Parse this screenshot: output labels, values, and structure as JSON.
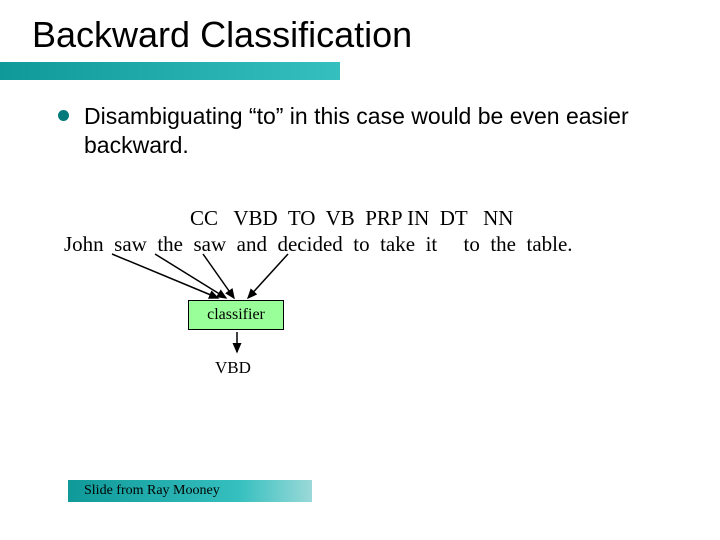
{
  "title": "Backward Classification",
  "bullet": "Disambiguating “to” in this case would be even easier backward.",
  "tags_line": "                        CC   VBD  TO  VB  PRP IN  DT   NN",
  "sentence_line": "John  saw  the  saw  and  decided  to  take  it     to  the  table.",
  "classifier_label": "classifier",
  "output_tag": "VBD",
  "footer": "Slide from Ray Mooney",
  "chart_data": {
    "type": "table",
    "title": "POS tag assignment example (backward classification step)",
    "tokens": [
      "John",
      "saw",
      "the",
      "saw",
      "and",
      "decided",
      "to",
      "take",
      "it",
      "to",
      "the",
      "table."
    ],
    "tags": [
      "",
      "",
      "",
      "",
      "CC",
      "VBD",
      "TO",
      "VB",
      "PRP",
      "IN",
      "DT",
      "NN"
    ],
    "classifier_inputs_token_indices": [
      1,
      2,
      3
    ],
    "classifier_feature_tag_index": 4,
    "classifier_output_tag": "VBD",
    "classifier_output_applies_to_token_index": 3
  }
}
